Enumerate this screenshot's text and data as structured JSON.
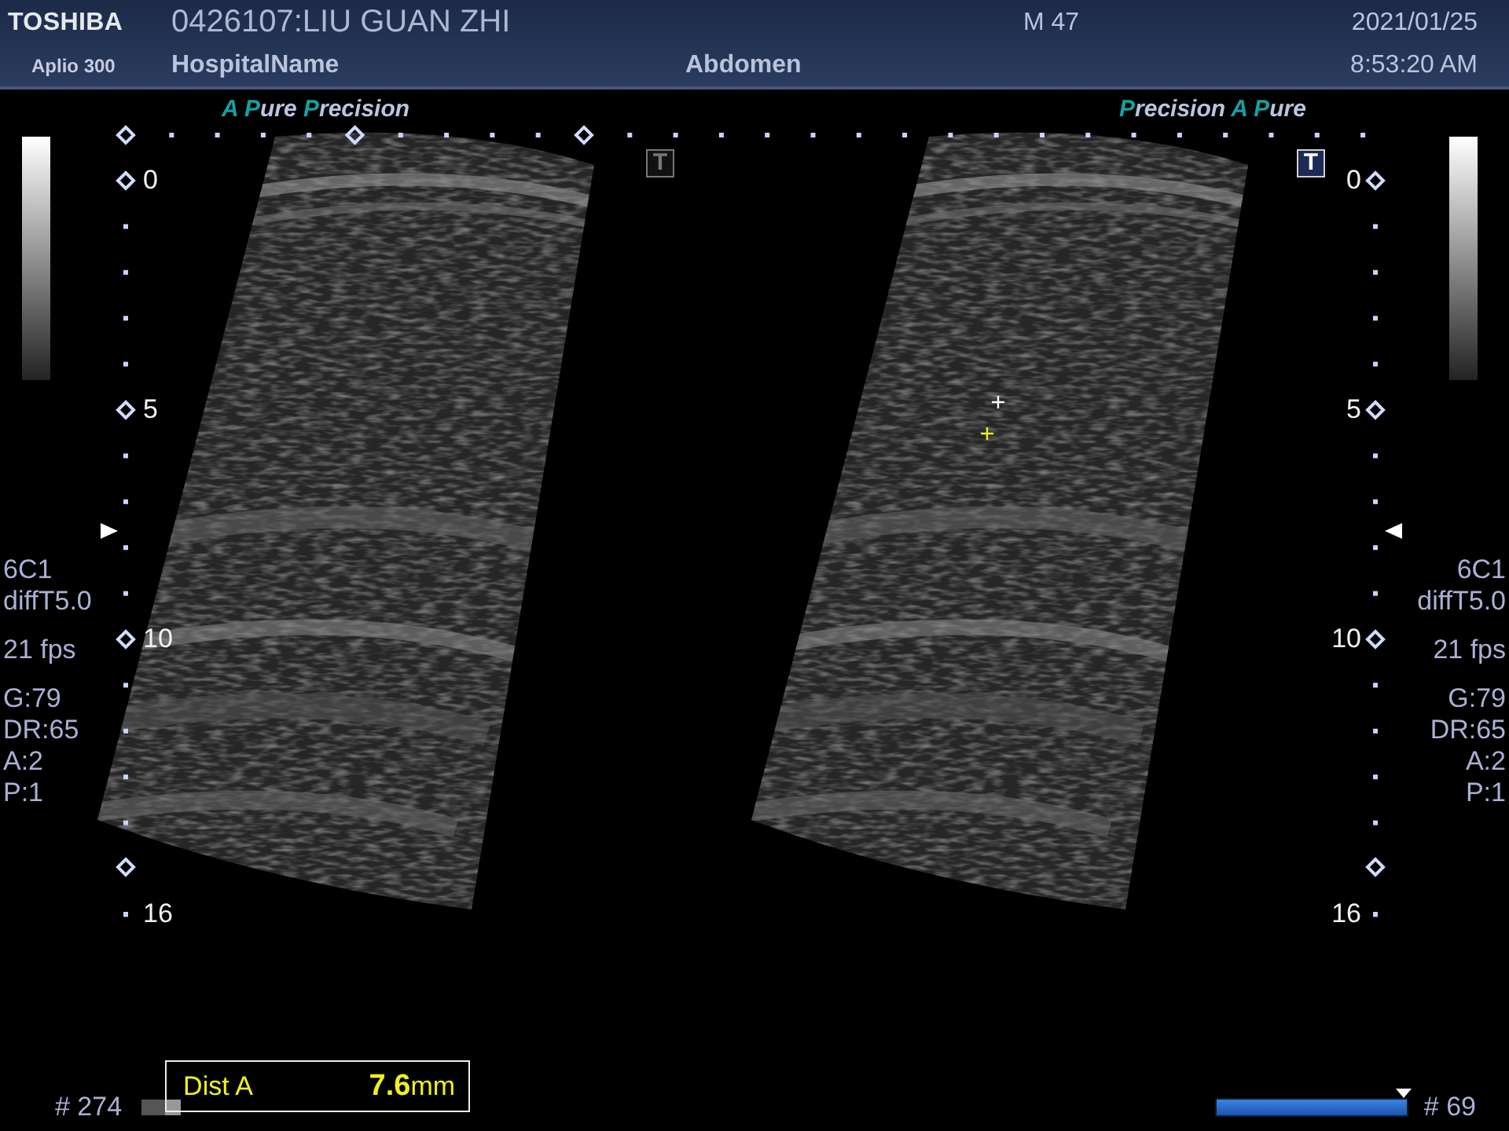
{
  "header": {
    "logo": "TOSHIBA",
    "model": "Aplio 300",
    "patient": "0426107:LIU GUAN ZHI",
    "hospital": "HospitalName",
    "sex_age": "M 47",
    "exam": "Abdomen",
    "date": "2021/01/25",
    "time": "8:53:20 AM"
  },
  "views": [
    {
      "brand": "A Pure Precision",
      "t_marker": {
        "label": "T",
        "selected": false
      },
      "depth_labels": [
        "0",
        "5",
        "10",
        "16"
      ],
      "params": [
        [
          "6C1",
          "diffT5.0"
        ],
        [
          "21 fps"
        ],
        [
          "G:79",
          "DR:65",
          "A:2",
          "P:1"
        ]
      ]
    },
    {
      "brand": "Precision A Pure",
      "t_marker": {
        "label": "T",
        "selected": true
      },
      "depth_labels": [
        "0",
        "5",
        "10",
        "16"
      ],
      "params": [
        [
          "6C1",
          "diffT5.0"
        ],
        [
          "21 fps"
        ],
        [
          "G:79",
          "DR:65",
          "A:2",
          "P:1"
        ]
      ]
    }
  ],
  "footer": {
    "frame_left": "# 274",
    "measurement": {
      "label": "Dist A",
      "value": "7.6",
      "unit": "mm"
    },
    "cine": {
      "level": 1.0
    },
    "frame_right": "# 69"
  }
}
